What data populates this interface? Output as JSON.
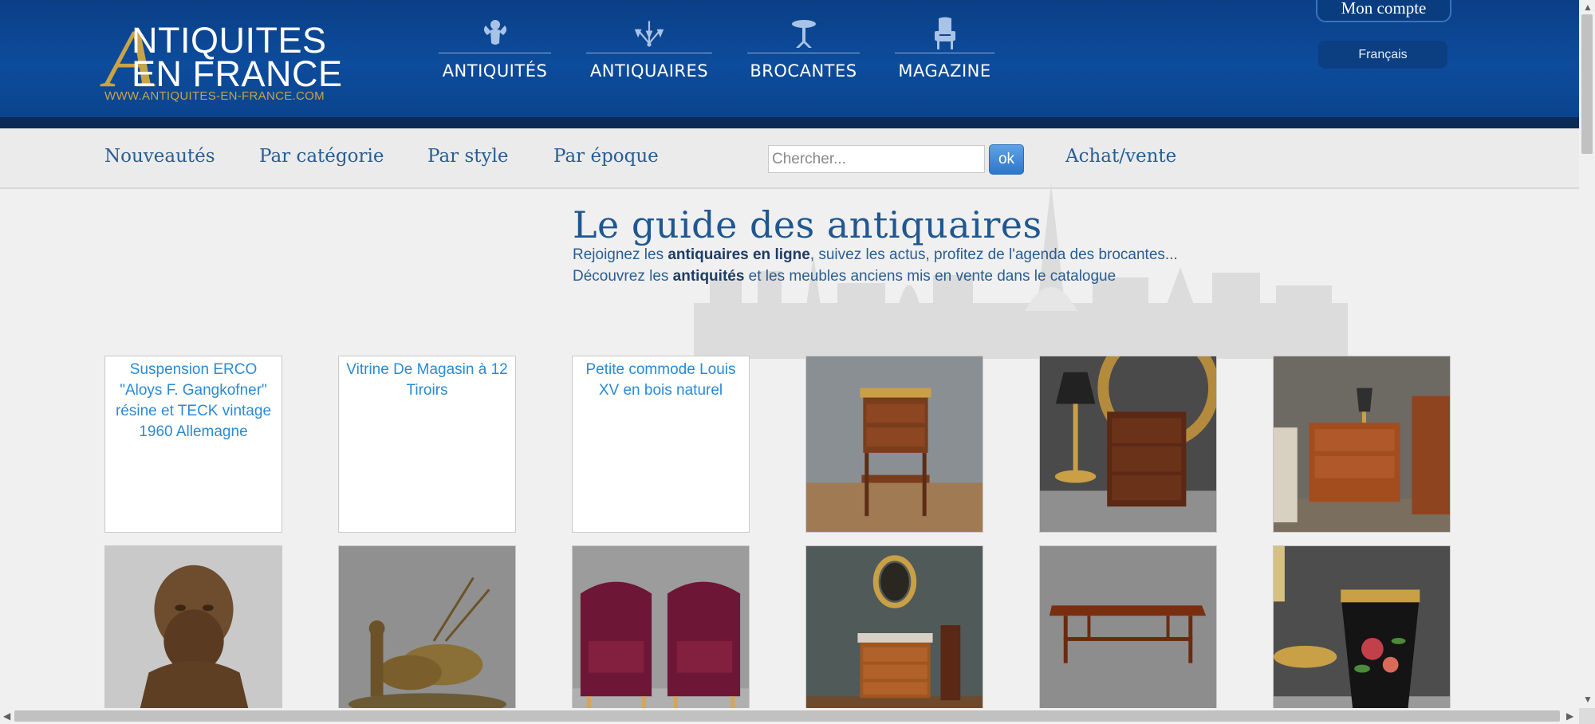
{
  "header": {
    "logo": {
      "big_letter": "A",
      "line1": "NTIQUITES",
      "line2": "EN FRANCE",
      "url": "WWW.ANTIQUITES-EN-FRANCE.COM"
    },
    "main_nav": [
      {
        "label": "ANTIQUITÉS",
        "icon": "cherub-icon"
      },
      {
        "label": "ANTIQUAIRES",
        "icon": "chandelier-icon"
      },
      {
        "label": "BROCANTES",
        "icon": "gueridon-table-icon"
      },
      {
        "label": "MAGAZINE",
        "icon": "armchair-icon"
      }
    ],
    "account_label": "Mon compte",
    "language": "Français"
  },
  "subnav": {
    "links": [
      "Nouveautés",
      "Par catégorie",
      "Par style",
      "Par époque"
    ],
    "search_placeholder": "Chercher...",
    "search_button": "ok",
    "buy_sell": "Achat/vente"
  },
  "intro": {
    "title": "Le guide des antiquaires",
    "line1_pre": "Rejoignez les ",
    "line1_bold": "antiquaires en ligne",
    "line1_post": ", suivez les actus, profitez de l'agenda des brocantes...",
    "line2_pre": "Découvrez les ",
    "line2_bold": "antiquités",
    "line2_post": " et les meubles anciens mis en vente dans le catalogue"
  },
  "products": [
    {
      "alt": "Suspension ERCO \"Aloys F. Gangkofner\" résine et TECK vintage 1960 Allemagne",
      "broken": true
    },
    {
      "alt": "Vitrine De Magasin à 12 Tiroirs",
      "broken": true
    },
    {
      "alt": "Petite commode Louis XV en bois naturel",
      "broken": true
    },
    {
      "alt": "",
      "broken": false,
      "picture": "oval-side-table"
    },
    {
      "alt": "",
      "broken": false,
      "picture": "nightstand-with-lamp"
    },
    {
      "alt": "",
      "broken": false,
      "picture": "bedside-table"
    },
    {
      "alt": "",
      "broken": false,
      "picture": "bronze-bust"
    },
    {
      "alt": "",
      "broken": false,
      "picture": "bronze-oxen-sculpture"
    },
    {
      "alt": "",
      "broken": false,
      "picture": "pair-velvet-armchairs"
    },
    {
      "alt": "",
      "broken": false,
      "picture": "commode-with-portrait"
    },
    {
      "alt": "",
      "broken": false,
      "picture": "coffee-table"
    },
    {
      "alt": "",
      "broken": false,
      "picture": "painted-tole-basket"
    }
  ],
  "colors": {
    "header_blue": "#0d4c9c",
    "gold": "#c9a347",
    "link_blue": "#285d94"
  }
}
